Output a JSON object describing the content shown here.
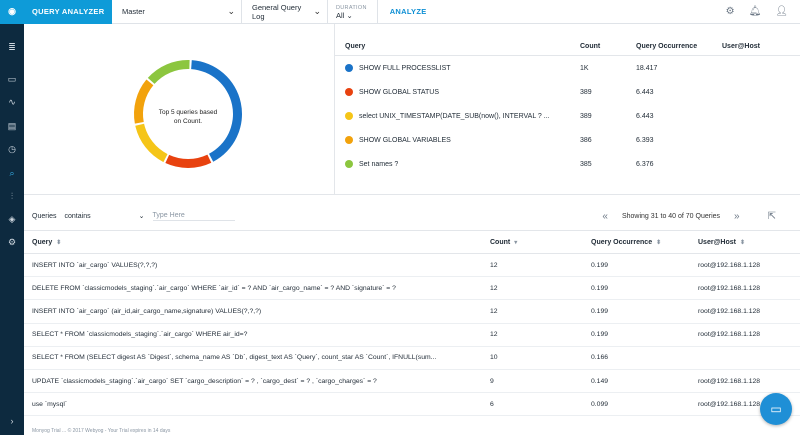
{
  "colors": {
    "accent": "#0e9bd8",
    "sidebar": "#0d2a3f",
    "blue": "#1a73c8",
    "orange": "#e8420f",
    "yellow": "#f5c518",
    "amber": "#f2a20c",
    "green": "#8cc63f"
  },
  "header": {
    "logo_icon": "db-logo-icon",
    "app_title": "QUERY ANALYZER",
    "server": "Master",
    "source": "General Query Log",
    "duration_label": "DURATION",
    "duration_value": "All",
    "analyze": "ANALYZE"
  },
  "donut": {
    "center_text": "Top 5 queries based on Count.",
    "slices": [
      {
        "color": "#1a73c8",
        "value": 18.417
      },
      {
        "color": "#e8420f",
        "value": 6.443
      },
      {
        "color": "#f5c518",
        "value": 6.443
      },
      {
        "color": "#f2a20c",
        "value": 6.393
      },
      {
        "color": "#8cc63f",
        "value": 6.376
      }
    ]
  },
  "top_queries": {
    "headers": {
      "query": "Query",
      "count": "Count",
      "occurrence": "Query Occurrence",
      "user": "User@Host"
    },
    "rows": [
      {
        "query": "SHOW FULL PROCESSLIST",
        "count": "1K",
        "occurrence": "18.417",
        "color": "#1a73c8"
      },
      {
        "query": "SHOW GLOBAL STATUS",
        "count": "389",
        "occurrence": "6.443",
        "color": "#e8420f"
      },
      {
        "query": "select UNIX_TIMESTAMP(DATE_SUB(now(), INTERVAL ? ...",
        "count": "389",
        "occurrence": "6.443",
        "color": "#f5c518"
      },
      {
        "query": "SHOW GLOBAL VARIABLES",
        "count": "386",
        "occurrence": "6.393",
        "color": "#f2a20c"
      },
      {
        "query": "Set names ?",
        "count": "385",
        "occurrence": "6.376",
        "color": "#8cc63f"
      }
    ]
  },
  "filter": {
    "label": "Queries",
    "operator": "contains",
    "placeholder": "Type Here",
    "pager_text": "Showing 31 to 40 of 70 Queries"
  },
  "table": {
    "headers": {
      "query": "Query",
      "count": "Count",
      "occurrence": "Query Occurrence",
      "user": "User@Host"
    },
    "rows": [
      {
        "query": "INSERT INTO `air_cargo` VALUES(?,?,?)",
        "count": "12",
        "occurrence": "0.199",
        "user": "root@192.168.1.128"
      },
      {
        "query": "DELETE FROM `classicmodels_staging`.`air_cargo` WHERE `air_id` = ? AND `air_cargo_name` = ? AND `signature` = ?",
        "count": "12",
        "occurrence": "0.199",
        "user": "root@192.168.1.128"
      },
      {
        "query": "INSERT INTO `air_cargo` (air_id,air_cargo_name,signature) VALUES(?,?,?)",
        "count": "12",
        "occurrence": "0.199",
        "user": "root@192.168.1.128"
      },
      {
        "query": "SELECT * FROM `classicmodels_staging`.`air_cargo` WHERE air_id=?",
        "count": "12",
        "occurrence": "0.199",
        "user": "root@192.168.1.128"
      },
      {
        "query": "SELECT * FROM (SELECT digest AS `Digest`, schema_name AS `Db`, digest_text AS `Query`, count_star AS `Count`, IFNULL(sum...",
        "count": "10",
        "occurrence": "0.166",
        "user": ""
      },
      {
        "query": "UPDATE `classicmodels_staging`.`air_cargo` SET `cargo_description` = ? , `cargo_dest` = ? , `cargo_charges` = ?",
        "count": "9",
        "occurrence": "0.149",
        "user": "root@192.168.1.128"
      },
      {
        "query": "use `mysql`",
        "count": "6",
        "occurrence": "0.099",
        "user": "root@192.168.1.128"
      }
    ]
  },
  "footer": {
    "text": "Monyog Trial ... © 2017 Webyog - Your Trial expires in 14 days"
  }
}
